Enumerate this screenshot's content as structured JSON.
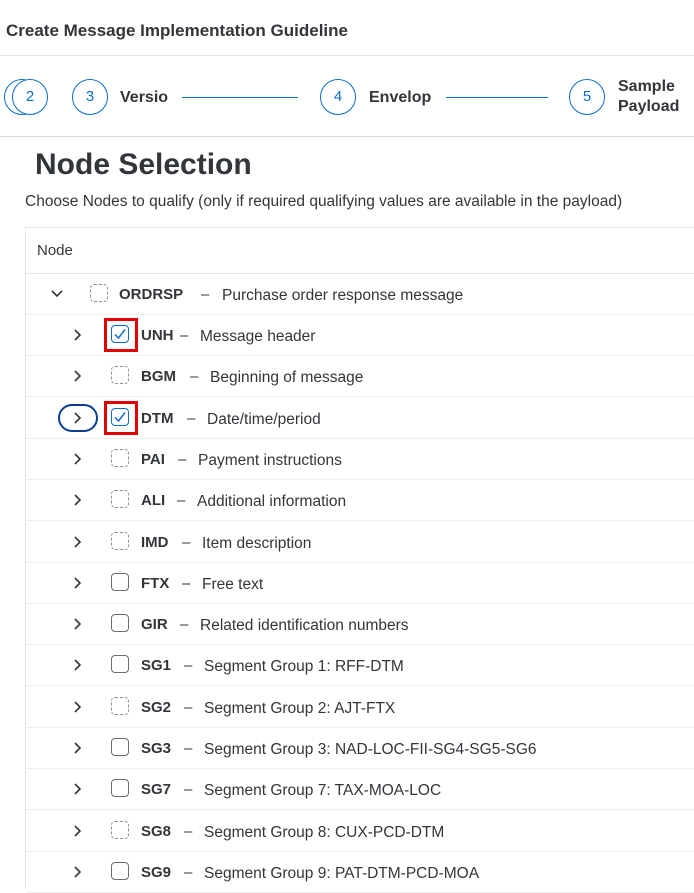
{
  "title": "Create Message Implementation Guideline",
  "wizard": {
    "steps": [
      {
        "number": "2",
        "label": ""
      },
      {
        "number": "3",
        "label": "Versio"
      },
      {
        "number": "4",
        "label": "Envelop"
      },
      {
        "number": "5",
        "label_line1": "Sample",
        "label_line2": "Payload"
      }
    ]
  },
  "page": {
    "heading": "Node Selection",
    "subtitle": "Choose Nodes to qualify (only if required qualifying values are available in the payload)"
  },
  "table": {
    "column_header": "Node",
    "root": {
      "code": "ORDRSP",
      "separator": "–",
      "description": "Purchase order response message",
      "checkbox": "dashed",
      "expanded": true
    },
    "rows": [
      {
        "code": "UNH",
        "separator": "–",
        "description": "Message header",
        "checkbox": "checked",
        "highlighted": true
      },
      {
        "code": "BGM",
        "separator": "–",
        "description": "Beginning of message",
        "checkbox": "dashed"
      },
      {
        "code": "DTM",
        "separator": "–",
        "description": "Date/time/period",
        "checkbox": "checked",
        "highlighted": true,
        "focused": true
      },
      {
        "code": "PAI",
        "separator": "–",
        "description": "Payment instructions",
        "checkbox": "dashed"
      },
      {
        "code": "ALI",
        "separator": "–",
        "description": "Additional information",
        "checkbox": "dashed"
      },
      {
        "code": "IMD",
        "separator": "–",
        "description": "Item description",
        "checkbox": "dashed"
      },
      {
        "code": "FTX",
        "separator": "–",
        "description": "Free text",
        "checkbox": "solid"
      },
      {
        "code": "GIR",
        "separator": "–",
        "description": "Related identification numbers",
        "checkbox": "solid"
      },
      {
        "code": "SG1",
        "separator": "–",
        "description": "Segment Group 1: RFF-DTM",
        "checkbox": "solid"
      },
      {
        "code": "SG2",
        "separator": "–",
        "description": "Segment Group 2: AJT-FTX",
        "checkbox": "dashed"
      },
      {
        "code": "SG3",
        "separator": "–",
        "description": "Segment Group 3: NAD-LOC-FII-SG4-SG5-SG6",
        "checkbox": "solid"
      },
      {
        "code": "SG7",
        "separator": "–",
        "description": "Segment Group 7: TAX-MOA-LOC",
        "checkbox": "solid"
      },
      {
        "code": "SG8",
        "separator": "–",
        "description": "Segment Group 8: CUX-PCD-DTM",
        "checkbox": "dashed"
      },
      {
        "code": "SG9",
        "separator": "–",
        "description": "Segment Group 9: PAT-DTM-PCD-MOA",
        "checkbox": "solid"
      }
    ]
  },
  "colors": {
    "accent": "#0a6ed1",
    "highlight": "#e00000",
    "text": "#32363a"
  }
}
